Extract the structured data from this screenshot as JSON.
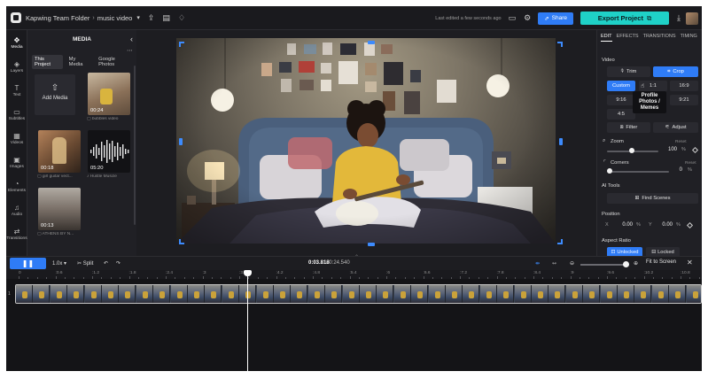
{
  "topbar": {
    "workspace": "Kapwing Team Folder",
    "project": "music video",
    "last_edited": "Last edited a few seconds ago",
    "share_label": "Share",
    "export_label": "Export Project"
  },
  "rail": {
    "items": [
      {
        "label": "Media",
        "icon": "media-icon",
        "active": true
      },
      {
        "label": "Layers",
        "icon": "layers-icon"
      },
      {
        "label": "Text",
        "icon": "text-icon"
      },
      {
        "label": "Subtitles",
        "icon": "subtitles-icon"
      },
      {
        "label": "Videos",
        "icon": "videos-icon"
      },
      {
        "label": "Images",
        "icon": "images-icon"
      },
      {
        "label": "Elements",
        "icon": "elements-icon"
      },
      {
        "label": "Audio",
        "icon": "audio-icon"
      },
      {
        "label": "Transitions",
        "icon": "transitions-icon"
      }
    ]
  },
  "media": {
    "title": "MEDIA",
    "tabs": [
      "This Project",
      "My Media",
      "Google Photos"
    ],
    "add_label": "Add Media",
    "items": [
      {
        "duration": "00:24",
        "caption": "bubbles video"
      },
      {
        "duration": "00:18",
        "caption": "girl guitar vect..."
      },
      {
        "duration": "05:20",
        "caption": "Hustle Muscle"
      },
      {
        "duration": "00:13",
        "caption": "ATHENS BY N..."
      }
    ]
  },
  "right_panel": {
    "tabs": [
      "EDIT",
      "EFFECTS",
      "TRANSITIONS",
      "TIMING"
    ],
    "video_label": "Video",
    "trim_label": "Trim",
    "crop_label": "Crop",
    "ratios": [
      "Custom",
      "1:1",
      "16:9",
      "9:16",
      "9:21",
      "4:5"
    ],
    "tooltip": "Profile Photos / Memes",
    "filter_label": "Filter",
    "adjust_label": "Adjust",
    "zoom_label": "Zoom",
    "zoom_reset": "Reset",
    "zoom_value": "100",
    "zoom_unit": "%",
    "corners_label": "Corners",
    "corners_reset": "Reset",
    "corners_value": "0",
    "corners_unit": "%",
    "ai_tools_label": "AI Tools",
    "find_scenes_label": "Find Scenes",
    "position_label": "Position",
    "pos_x_label": "X",
    "pos_x_value": "0.00",
    "pos_y_label": "Y",
    "pos_y_value": "0.00",
    "pos_unit": "%",
    "aspect_label": "Aspect Ratio",
    "unlocked_label": "Unlocked",
    "locked_label": "Locked"
  },
  "timeline": {
    "speed": "1.0x",
    "split_label": "Split",
    "current_time": "0:03.818",
    "total_time": "/ 0:24.540",
    "fit_label": "Fit to Screen",
    "zoom_level": 0.88,
    "playhead_time": 3.818,
    "ticks": [
      "0",
      ":0.6",
      ":1.2",
      ":1.8",
      ":2.4",
      ":3",
      ":3.6",
      ":4.2",
      ":4.8",
      ":5.4",
      ":6",
      ":6.6",
      ":7.2",
      ":7.8",
      ":8.4",
      ":9",
      ":9.6",
      ":10.2",
      ":10.8"
    ],
    "track_number": "1"
  }
}
